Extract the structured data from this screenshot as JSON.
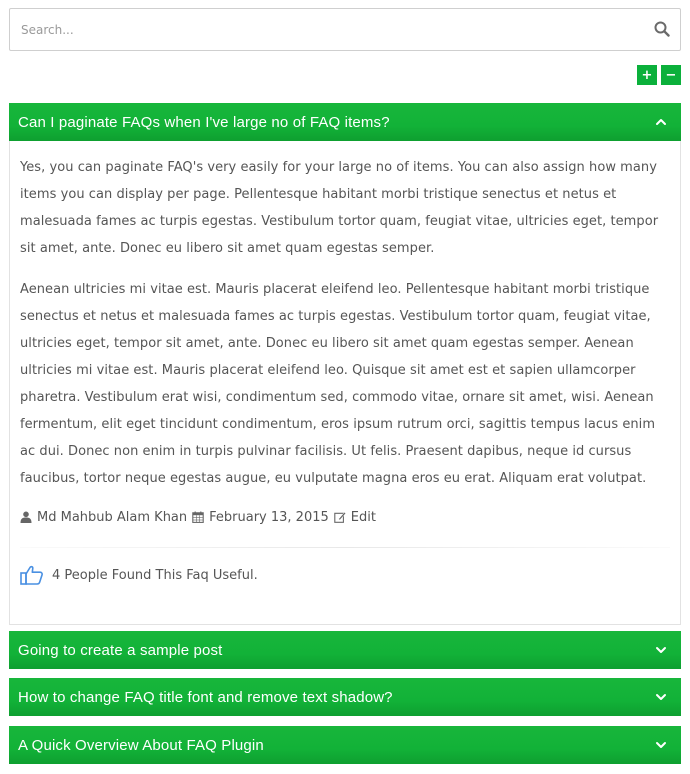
{
  "search": {
    "placeholder": "Search..."
  },
  "controls": {
    "expand_symbol": "+",
    "collapse_symbol": "−"
  },
  "colors": {
    "accent": "#12b238",
    "text": "#555555",
    "like_blue": "#4a90e2"
  },
  "faqs": [
    {
      "title": "Can I paginate FAQs when I've large no of FAQ items?",
      "expanded": true,
      "paragraphs": [
        "Yes, you can paginate FAQ's very easily for your large no of items. You can also assign how many items you can display per page. Pellentesque habitant morbi tristique senectus et netus et malesuada fames ac turpis egestas. Vestibulum tortor quam, feugiat vitae, ultricies eget, tempor sit amet, ante. Donec eu libero sit amet quam egestas semper.",
        "Aenean ultricies mi vitae est. Mauris placerat eleifend leo. Pellentesque habitant morbi tristique senectus et netus et malesuada fames ac turpis egestas. Vestibulum tortor quam, feugiat vitae, ultricies eget, tempor sit amet, ante. Donec eu libero sit amet quam egestas semper. Aenean ultricies mi vitae est. Mauris placerat eleifend leo. Quisque sit amet est et sapien ullamcorper pharetra. Vestibulum erat wisi, condimentum sed, commodo vitae, ornare sit amet, wisi. Aenean fermentum, elit eget tincidunt condimentum, eros ipsum rutrum orci, sagittis tempus lacus enim ac dui. Donec non enim in turpis pulvinar facilisis. Ut felis. Praesent dapibus, neque id cursus faucibus, tortor neque egestas augue, eu vulputate magna eros eu erat. Aliquam erat volutpat."
      ],
      "author": "Md Mahbub Alam Khan",
      "date": "February 13, 2015",
      "edit_label": "Edit",
      "useful_text": "4 People Found This Faq Useful."
    },
    {
      "title": "Going to create a sample post",
      "expanded": false
    },
    {
      "title": "How to change FAQ title font and remove text shadow?",
      "expanded": false
    },
    {
      "title": "A Quick Overview About FAQ Plugin",
      "expanded": false
    }
  ]
}
